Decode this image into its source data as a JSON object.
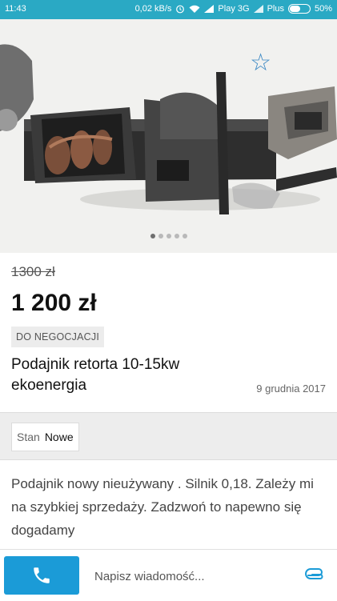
{
  "status_bar": {
    "time": "11:43",
    "speed": "0,02 kB/s",
    "carrier1": "Play 3G",
    "carrier2": "Plus",
    "battery_text": "50%",
    "battery_level": 0.5
  },
  "gallery": {
    "image_count": 5,
    "active_index": 0,
    "favorite_icon": "star-outline-icon"
  },
  "listing": {
    "old_price": "1300 zł",
    "price": "1 200 zł",
    "negotiable_badge": "DO NEGOCJACJI",
    "title": "Podajnik retorta 10-15kw ekoenergia",
    "date": "9 grudnia 2017",
    "condition_label": "Stan",
    "condition_value": "Nowe",
    "description": "Podajnik nowy nieużywany . Silnik 0,18. Zależy mi na szybkiej sprzedaży. Zadzwoń to napewno się dogadamy"
  },
  "bottom_bar": {
    "call_icon": "phone-icon",
    "message_placeholder": "Napisz wiadomość...",
    "attach_icon": "paperclip-icon"
  },
  "colors": {
    "status_bar": "#2aa9c4",
    "accent": "#1b9bd7",
    "star": "#3b88c4"
  }
}
